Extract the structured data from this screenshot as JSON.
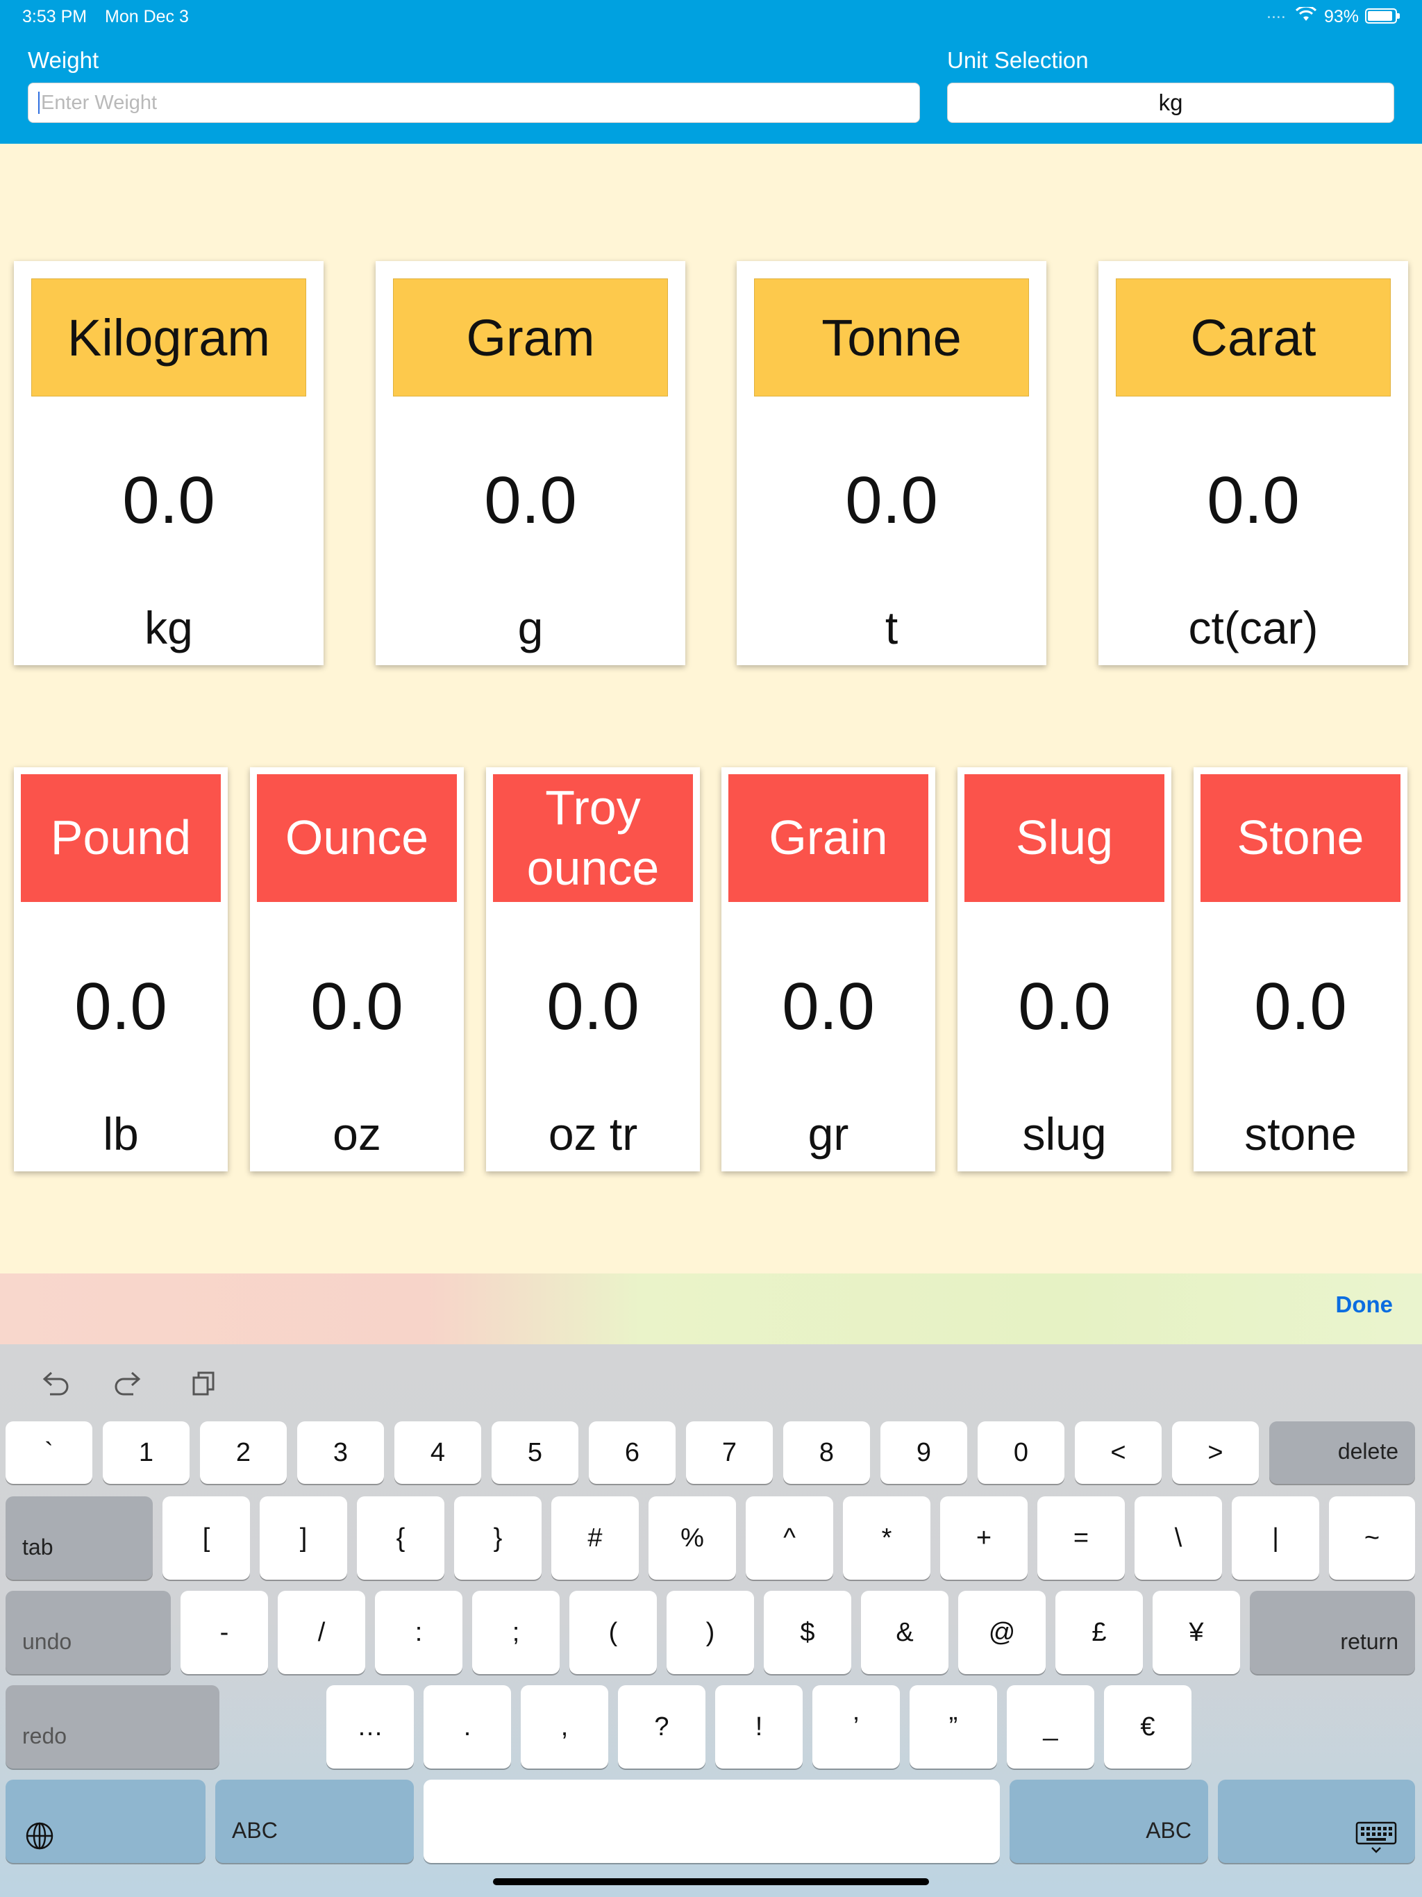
{
  "status_bar": {
    "time": "3:53 PM",
    "date": "Mon Dec 3",
    "signal": "....",
    "battery_text": "93%",
    "battery_level": 0.93
  },
  "header": {
    "weight_label": "Weight",
    "weight_placeholder": "Enter Weight",
    "unit_label": "Unit Selection",
    "unit_value": "kg",
    "bg_color": "#00a1e0"
  },
  "metric_cards": [
    {
      "name": "Kilogram",
      "value": "0.0",
      "unit": "kg"
    },
    {
      "name": "Gram",
      "value": "0.0",
      "unit": "g"
    },
    {
      "name": "Tonne",
      "value": "0.0",
      "unit": "t"
    },
    {
      "name": "Carat",
      "value": "0.0",
      "unit": "ct(car)"
    }
  ],
  "imperial_cards": [
    {
      "name": "Pound",
      "value": "0.0",
      "unit": "lb"
    },
    {
      "name": "Ounce",
      "value": "0.0",
      "unit": "oz"
    },
    {
      "name": "Troy ounce",
      "value": "0.0",
      "unit": "oz tr"
    },
    {
      "name": "Grain",
      "value": "0.0",
      "unit": "gr"
    },
    {
      "name": "Slug",
      "value": "0.0",
      "unit": "slug"
    },
    {
      "name": "Stone",
      "value": "0.0",
      "unit": "stone"
    }
  ],
  "colors": {
    "metric_header": "#fdc94c",
    "imperial_header": "#fb534b",
    "page_bg": "#fff5d6"
  },
  "keyboard": {
    "done_label": "Done",
    "toolbar_icons": [
      "undo-icon",
      "redo-icon",
      "clipboard-icon"
    ],
    "row1": [
      "`",
      "1",
      "2",
      "3",
      "4",
      "5",
      "6",
      "7",
      "8",
      "9",
      "0",
      "<",
      ">"
    ],
    "delete_label": "delete",
    "tab_label": "tab",
    "row2": [
      "[",
      "]",
      "{",
      "}",
      "#",
      "%",
      "^",
      "*",
      "+",
      "=",
      "\\",
      "|",
      "~"
    ],
    "undo_label": "undo",
    "row3": [
      "-",
      "/",
      ":",
      ";",
      "(",
      ")",
      "$",
      "&",
      "@",
      "£",
      "¥"
    ],
    "return_label": "return",
    "redo_label": "redo",
    "row4": [
      "…",
      ".",
      ",",
      "?",
      "!",
      "’",
      "”",
      "_",
      "€"
    ],
    "abc_left": "ABC",
    "abc_right": "ABC"
  }
}
